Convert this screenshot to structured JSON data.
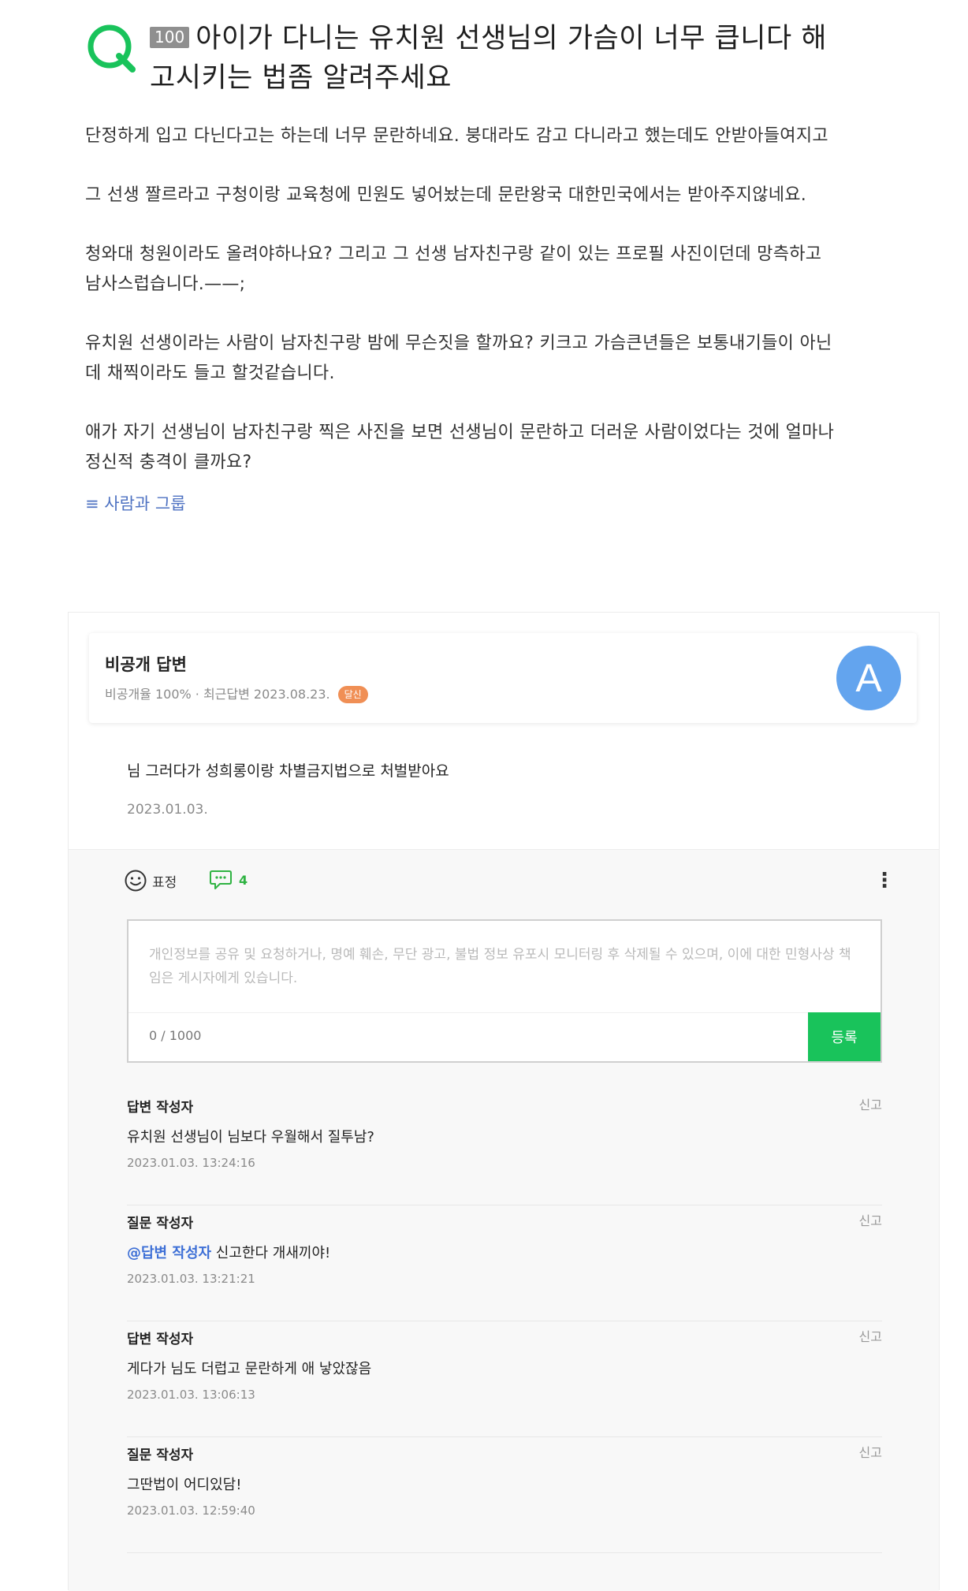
{
  "question": {
    "badge": "100",
    "title": "아이가 다니는 유치원 선생님의 가슴이 너무 큽니다 해고시키는 법좀 알려주세요",
    "paragraphs": [
      "단정하게 입고 다닌다고는 하는데 너무 문란하네요. 붕대라도 감고 다니라고 했는데도 안받아들여지고",
      "그 선생 짤르라고 구청이랑 교육청에 민원도 넣어놨는데 문란왕국 대한민국에서는 받아주지않네요.",
      "청와대 청원이라도 올려야하나요? 그리고 그 선생 남자친구랑 같이 있는 프로필 사진이던데 망측하고 남사스럽습니다.——;",
      "유치원 선생이라는 사람이 남자친구랑 밤에 무슨짓을 할까요? 키크고 가슴큰년들은 보통내기들이 아닌데 채찍이라도 들고 할것같습니다.",
      "애가 자기 선생님이 남자친구랑 찍은 사진을 보면 선생님이 문란하고 더러운 사람이었다는 것에 얼마나 정신적 충격이 클까요?"
    ],
    "tag": "≡ 사람과 그룹"
  },
  "answer": {
    "name": "비공개 답변",
    "meta": "비공개율 100% · 최근답변 2023.08.23.",
    "badge": "달신",
    "avatar_letter": "A",
    "text": "님 그러다가 성희롱이랑 차별금지법으로 처벌받아요",
    "date": "2023.01.03."
  },
  "actions": {
    "emoji_label": "표정",
    "comment_count": "4",
    "more": "⋮"
  },
  "comment_box": {
    "placeholder": "개인정보를 공유 및 요청하거나, 명예 훼손, 무단 광고, 불법 정보 유포시 모니터링 후 삭제될 수 있으며, 이에 대한 민형사상 책임은 게시자에게 있습니다.",
    "counter": "0 / 1000",
    "submit": "등록"
  },
  "comments": [
    {
      "author": "답변 작성자",
      "mention": "",
      "text": "유치원 선생님이 님보다 우월해서 질투남?",
      "time": "2023.01.03. 13:24:16",
      "report": "신고"
    },
    {
      "author": "질문 작성자",
      "mention": "@답변 작성자",
      "text": " 신고한다 개새끼야!",
      "time": "2023.01.03. 13:21:21",
      "report": "신고"
    },
    {
      "author": "답변 작성자",
      "mention": "",
      "text": "게다가 님도 더럽고 문란하게 애 낳았잖음",
      "time": "2023.01.03. 13:06:13",
      "report": "신고"
    },
    {
      "author": "질문 작성자",
      "mention": "",
      "text": "그딴법이 어디있담!",
      "time": "2023.01.03. 12:59:40",
      "report": "신고"
    }
  ],
  "colors": {
    "brand_green": "#19c35b",
    "mention_blue": "#3d6fd6",
    "avatar_blue": "#63a4ee",
    "badge_orange": "#f08f55"
  }
}
